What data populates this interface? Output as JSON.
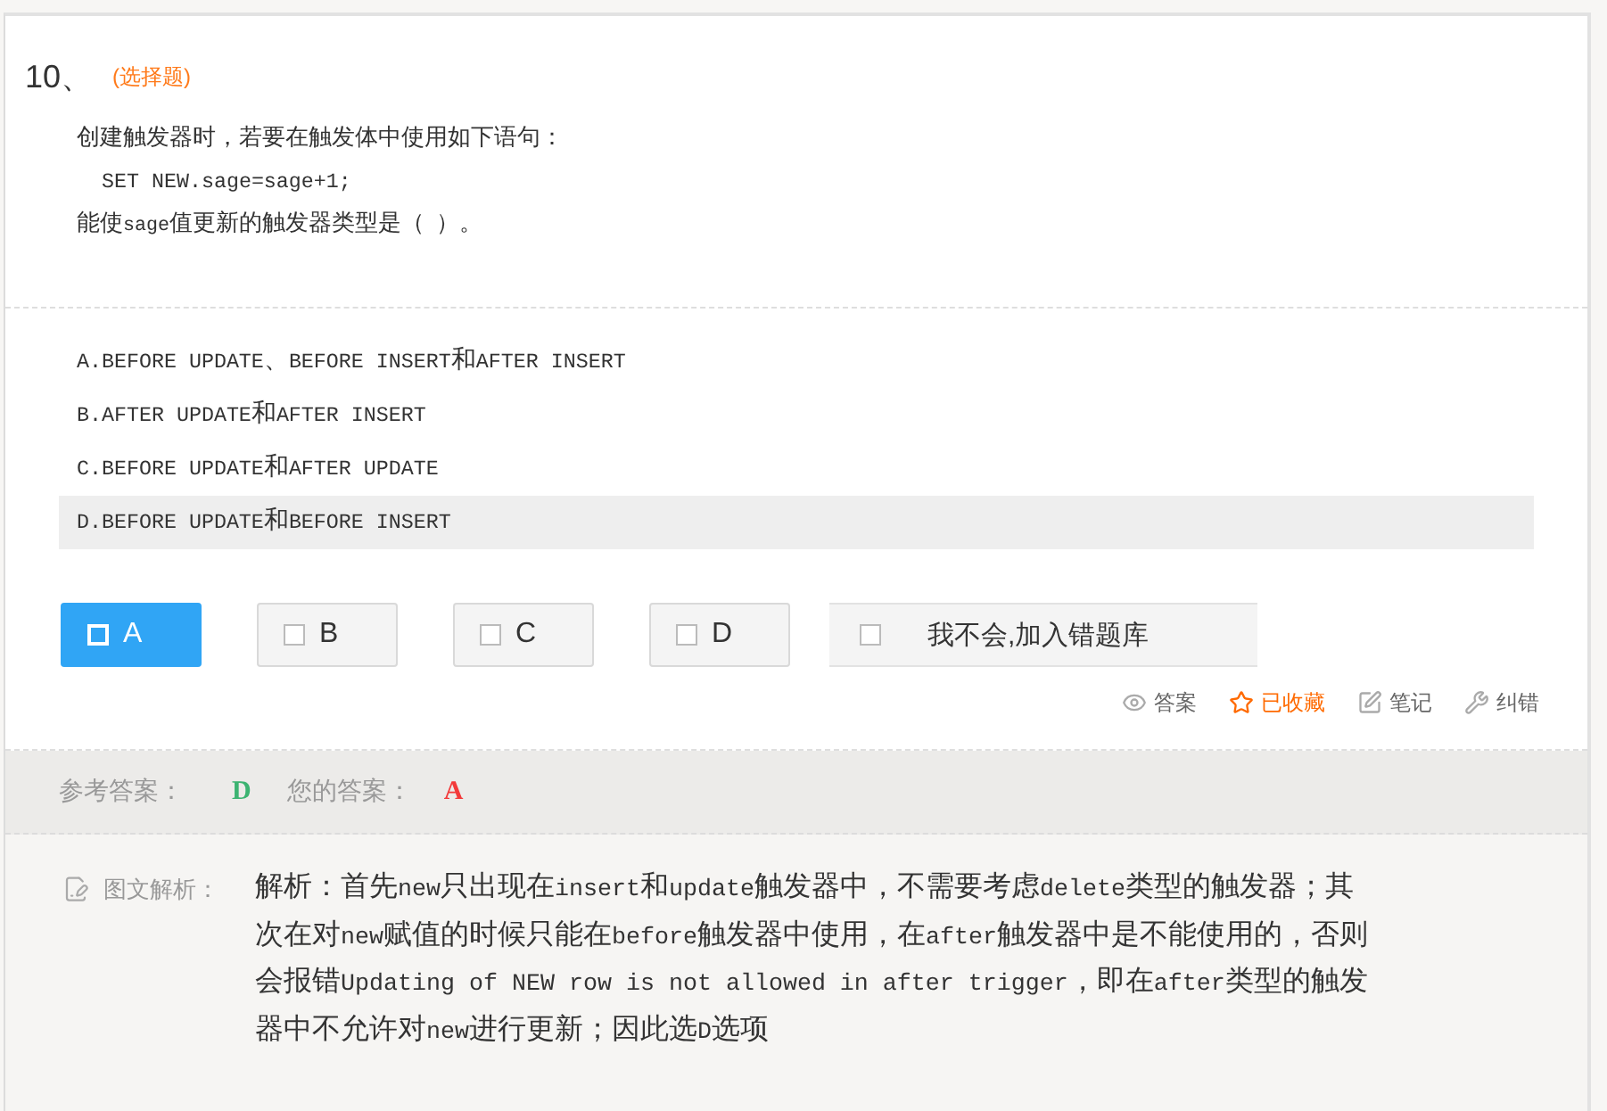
{
  "question": {
    "number": "10、",
    "type": "(选择题)",
    "stem": [
      {
        "kind": "text",
        "text": "创建触发器时，若要在触发体中使用如下语句："
      },
      {
        "kind": "code",
        "text": "SET NEW.sage=sage+1;"
      },
      {
        "kind": "text",
        "text": "能使sage值更新的触发器类型是（ ）。"
      }
    ]
  },
  "options": [
    {
      "text": "A.BEFORE UPDATE、BEFORE INSERT和AFTER INSERT",
      "highlighted": false
    },
    {
      "text": "B.AFTER UPDATE和AFTER INSERT",
      "highlighted": false
    },
    {
      "text": "C.BEFORE UPDATE和AFTER UPDATE",
      "highlighted": false
    },
    {
      "text": "D.BEFORE UPDATE和BEFORE INSERT",
      "highlighted": true
    }
  ],
  "choices": [
    {
      "label": "A",
      "selected": true
    },
    {
      "label": "B",
      "selected": false
    },
    {
      "label": "C",
      "selected": false
    },
    {
      "label": "D",
      "selected": false
    }
  ],
  "unknown_button": {
    "label": "我不会,加入错题库",
    "checked": false
  },
  "actions": [
    {
      "kind": "answer",
      "label": "答案",
      "active": false
    },
    {
      "kind": "favorite",
      "label": "已收藏",
      "active": true
    },
    {
      "kind": "note",
      "label": "笔记",
      "active": false
    },
    {
      "kind": "report",
      "label": "纠错",
      "active": false
    }
  ],
  "answer_bar": {
    "reference_label": "参考答案：",
    "reference_value": "D",
    "your_label": "您的答案：",
    "your_value": "A",
    "your_correct": false
  },
  "explanation": {
    "label": "图文解析：",
    "text": "解析：首先new只出现在insert和update触发器中，不需要考虑delete类型的触发器；其次在对new赋值的时候只能在before触发器中使用，在after触发器中是不能使用的，否则会报错Updating of NEW row is not allowed in after trigger，即在after类型的触发器中不允许对new进行更新；因此选D选项"
  }
}
